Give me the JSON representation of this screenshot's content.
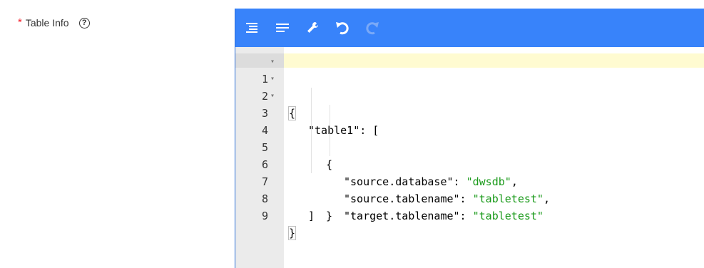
{
  "field": {
    "required_mark": "*",
    "label": "Table Info",
    "help_icon": "question-circle-icon"
  },
  "toolbar": {
    "icons": [
      "format-json-icon",
      "compact-json-icon",
      "repair-wrench-icon",
      "undo-icon",
      "redo-icon"
    ],
    "color": "#3883fa"
  },
  "editor": {
    "line_numbers": [
      "1",
      "2",
      "3",
      "4",
      "5",
      "6",
      "7",
      "8",
      "9"
    ],
    "lines": [
      "{",
      "\"table1\": [",
      "{",
      "\"source.database\": \"dwsdb\",",
      "\"source.tablename\": \"tabletest\",",
      "\"target.tablename\": \"tabletest\"",
      "}",
      "]",
      "}"
    ],
    "key_text": [
      "\"source.database\": ",
      "\"source.tablename\": ",
      "\"target.tablename\": "
    ],
    "value_text": [
      "\"dwsdb\"",
      "\"tabletest\"",
      "\"tabletest\""
    ],
    "punct": [
      ",",
      ",",
      ""
    ]
  }
}
